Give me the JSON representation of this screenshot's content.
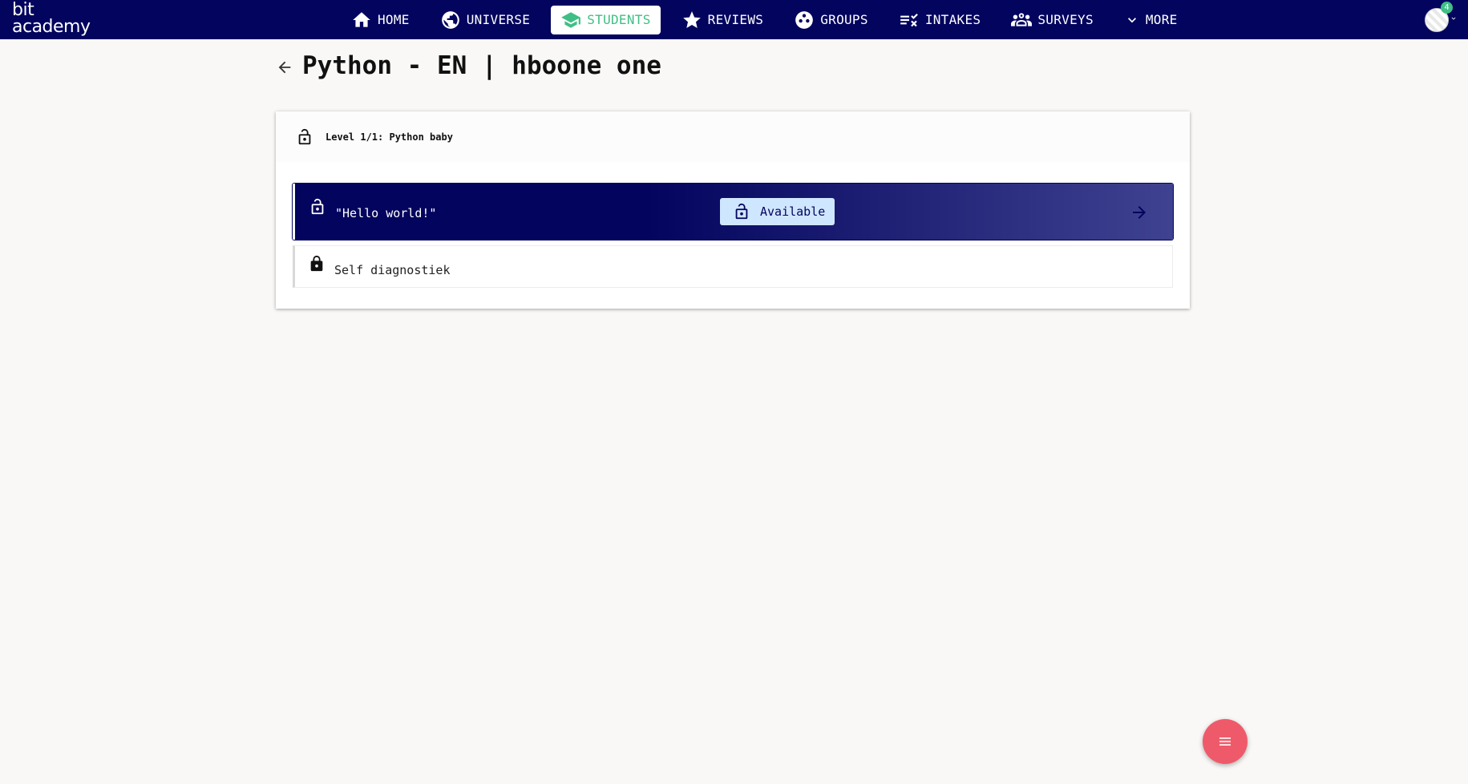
{
  "navbar": {
    "logo_line1": "bit",
    "logo_line2": "academy",
    "items": [
      {
        "label": "HOME",
        "icon": "home-icon",
        "active": false
      },
      {
        "label": "UNIVERSE",
        "icon": "globe-icon",
        "active": false
      },
      {
        "label": "STUDENTS",
        "icon": "graduation-cap-icon",
        "active": true
      },
      {
        "label": "REVIEWS",
        "icon": "star-icon",
        "active": false
      },
      {
        "label": "GROUPS",
        "icon": "groups-icon",
        "active": false
      },
      {
        "label": "INTAKES",
        "icon": "checklist-icon",
        "active": false
      },
      {
        "label": "SURVEYS",
        "icon": "people-icon",
        "active": false
      },
      {
        "label": "MORE",
        "icon": "chevron-down-icon",
        "active": false
      }
    ],
    "notification_count": "4"
  },
  "page": {
    "title": "Python - EN | hboone one"
  },
  "card": {
    "level_label": "Level 1/1: Python baby",
    "rows": [
      {
        "label": "\"Hello world!\"",
        "status": "Available",
        "locked": false
      },
      {
        "label": "Self diagnostiek",
        "locked": true
      }
    ]
  },
  "colors": {
    "navbar_bg": "#03045e",
    "accent_green": "#3fbf85",
    "fab_red": "#ef5a6a",
    "status_pill_bg": "#cfe6ff"
  }
}
